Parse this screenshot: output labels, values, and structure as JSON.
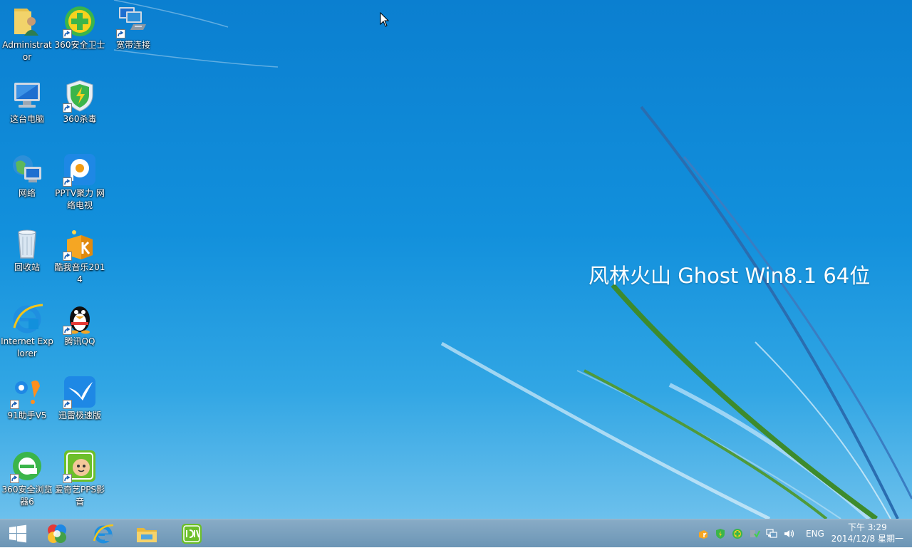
{
  "desktop": {
    "watermark": "风林火山 Ghost Win8.1 64位",
    "icons": [
      {
        "label": "Administrator"
      },
      {
        "label": "这台电脑"
      },
      {
        "label": "网络"
      },
      {
        "label": "回收站"
      },
      {
        "label": "Internet Explorer"
      },
      {
        "label": "91助手V5"
      },
      {
        "label": "360安全浏览器6"
      },
      {
        "label": "360安全卫士"
      },
      {
        "label": "360杀毒"
      },
      {
        "label": "PPTV聚力 网络电视"
      },
      {
        "label": "酷我音乐2014"
      },
      {
        "label": "腾讯QQ"
      },
      {
        "label": "迅雷极速版"
      },
      {
        "label": "爱奇艺PPS影音"
      },
      {
        "label": "宽带连接"
      }
    ]
  },
  "taskbar": {
    "pinned": [
      {
        "icon": "start-button-windows-logo"
      },
      {
        "icon": "360-software-manager-icon"
      },
      {
        "icon": "internet-explorer-icon"
      },
      {
        "icon": "file-explorer-icon"
      },
      {
        "icon": "iqiyi-icon"
      }
    ],
    "tray": {
      "language": "ENG",
      "time": "下午 3:29",
      "date": "2014/12/8 星期一"
    }
  },
  "colors": {
    "desktop_top": "#0b7fd0",
    "desktop_bottom": "#6cc0ec",
    "accent_green": "#3d8b2d"
  }
}
